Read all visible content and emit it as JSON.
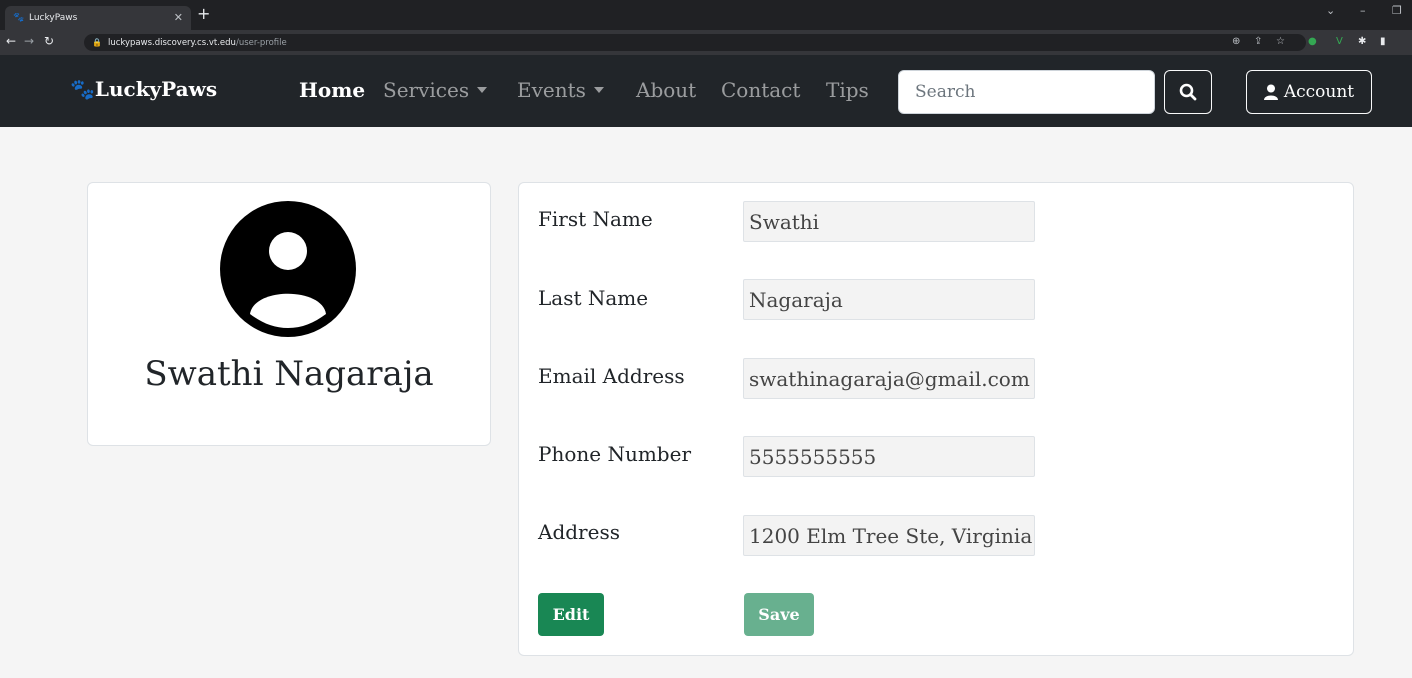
{
  "browser": {
    "tab_title": "LuckyPaws",
    "new_tab_icon": "+",
    "url_host": "luckypaws.discovery.cs.vt.edu",
    "url_path": "/user-profile"
  },
  "navbar": {
    "brand": "LuckyPaws",
    "brand_icon": "paw-icon",
    "items": [
      {
        "label": "Home",
        "active": true
      },
      {
        "label": "Services",
        "dropdown": true
      },
      {
        "label": "Events",
        "dropdown": true
      },
      {
        "label": "About"
      },
      {
        "label": "Contact"
      },
      {
        "label": "Tips"
      }
    ],
    "search_placeholder": "Search",
    "account_label": "Account"
  },
  "profile": {
    "name": "Swathi Nagaraja",
    "avatar_icon": "user-circle-icon"
  },
  "form": {
    "fields": [
      {
        "label": "First Name",
        "value": "Swathi"
      },
      {
        "label": "Last Name",
        "value": "Nagaraja"
      },
      {
        "label": "Email Address",
        "value": "swathinagaraja@gmail.com"
      },
      {
        "label": "Phone Number",
        "value": "5555555555"
      },
      {
        "label": "Address",
        "value": "1200 Elm Tree Ste, Virginia"
      }
    ],
    "edit_label": "Edit",
    "save_label": "Save"
  },
  "colors": {
    "navbar_bg": "#212529",
    "page_bg": "#f5f5f5",
    "success": "#198754"
  }
}
